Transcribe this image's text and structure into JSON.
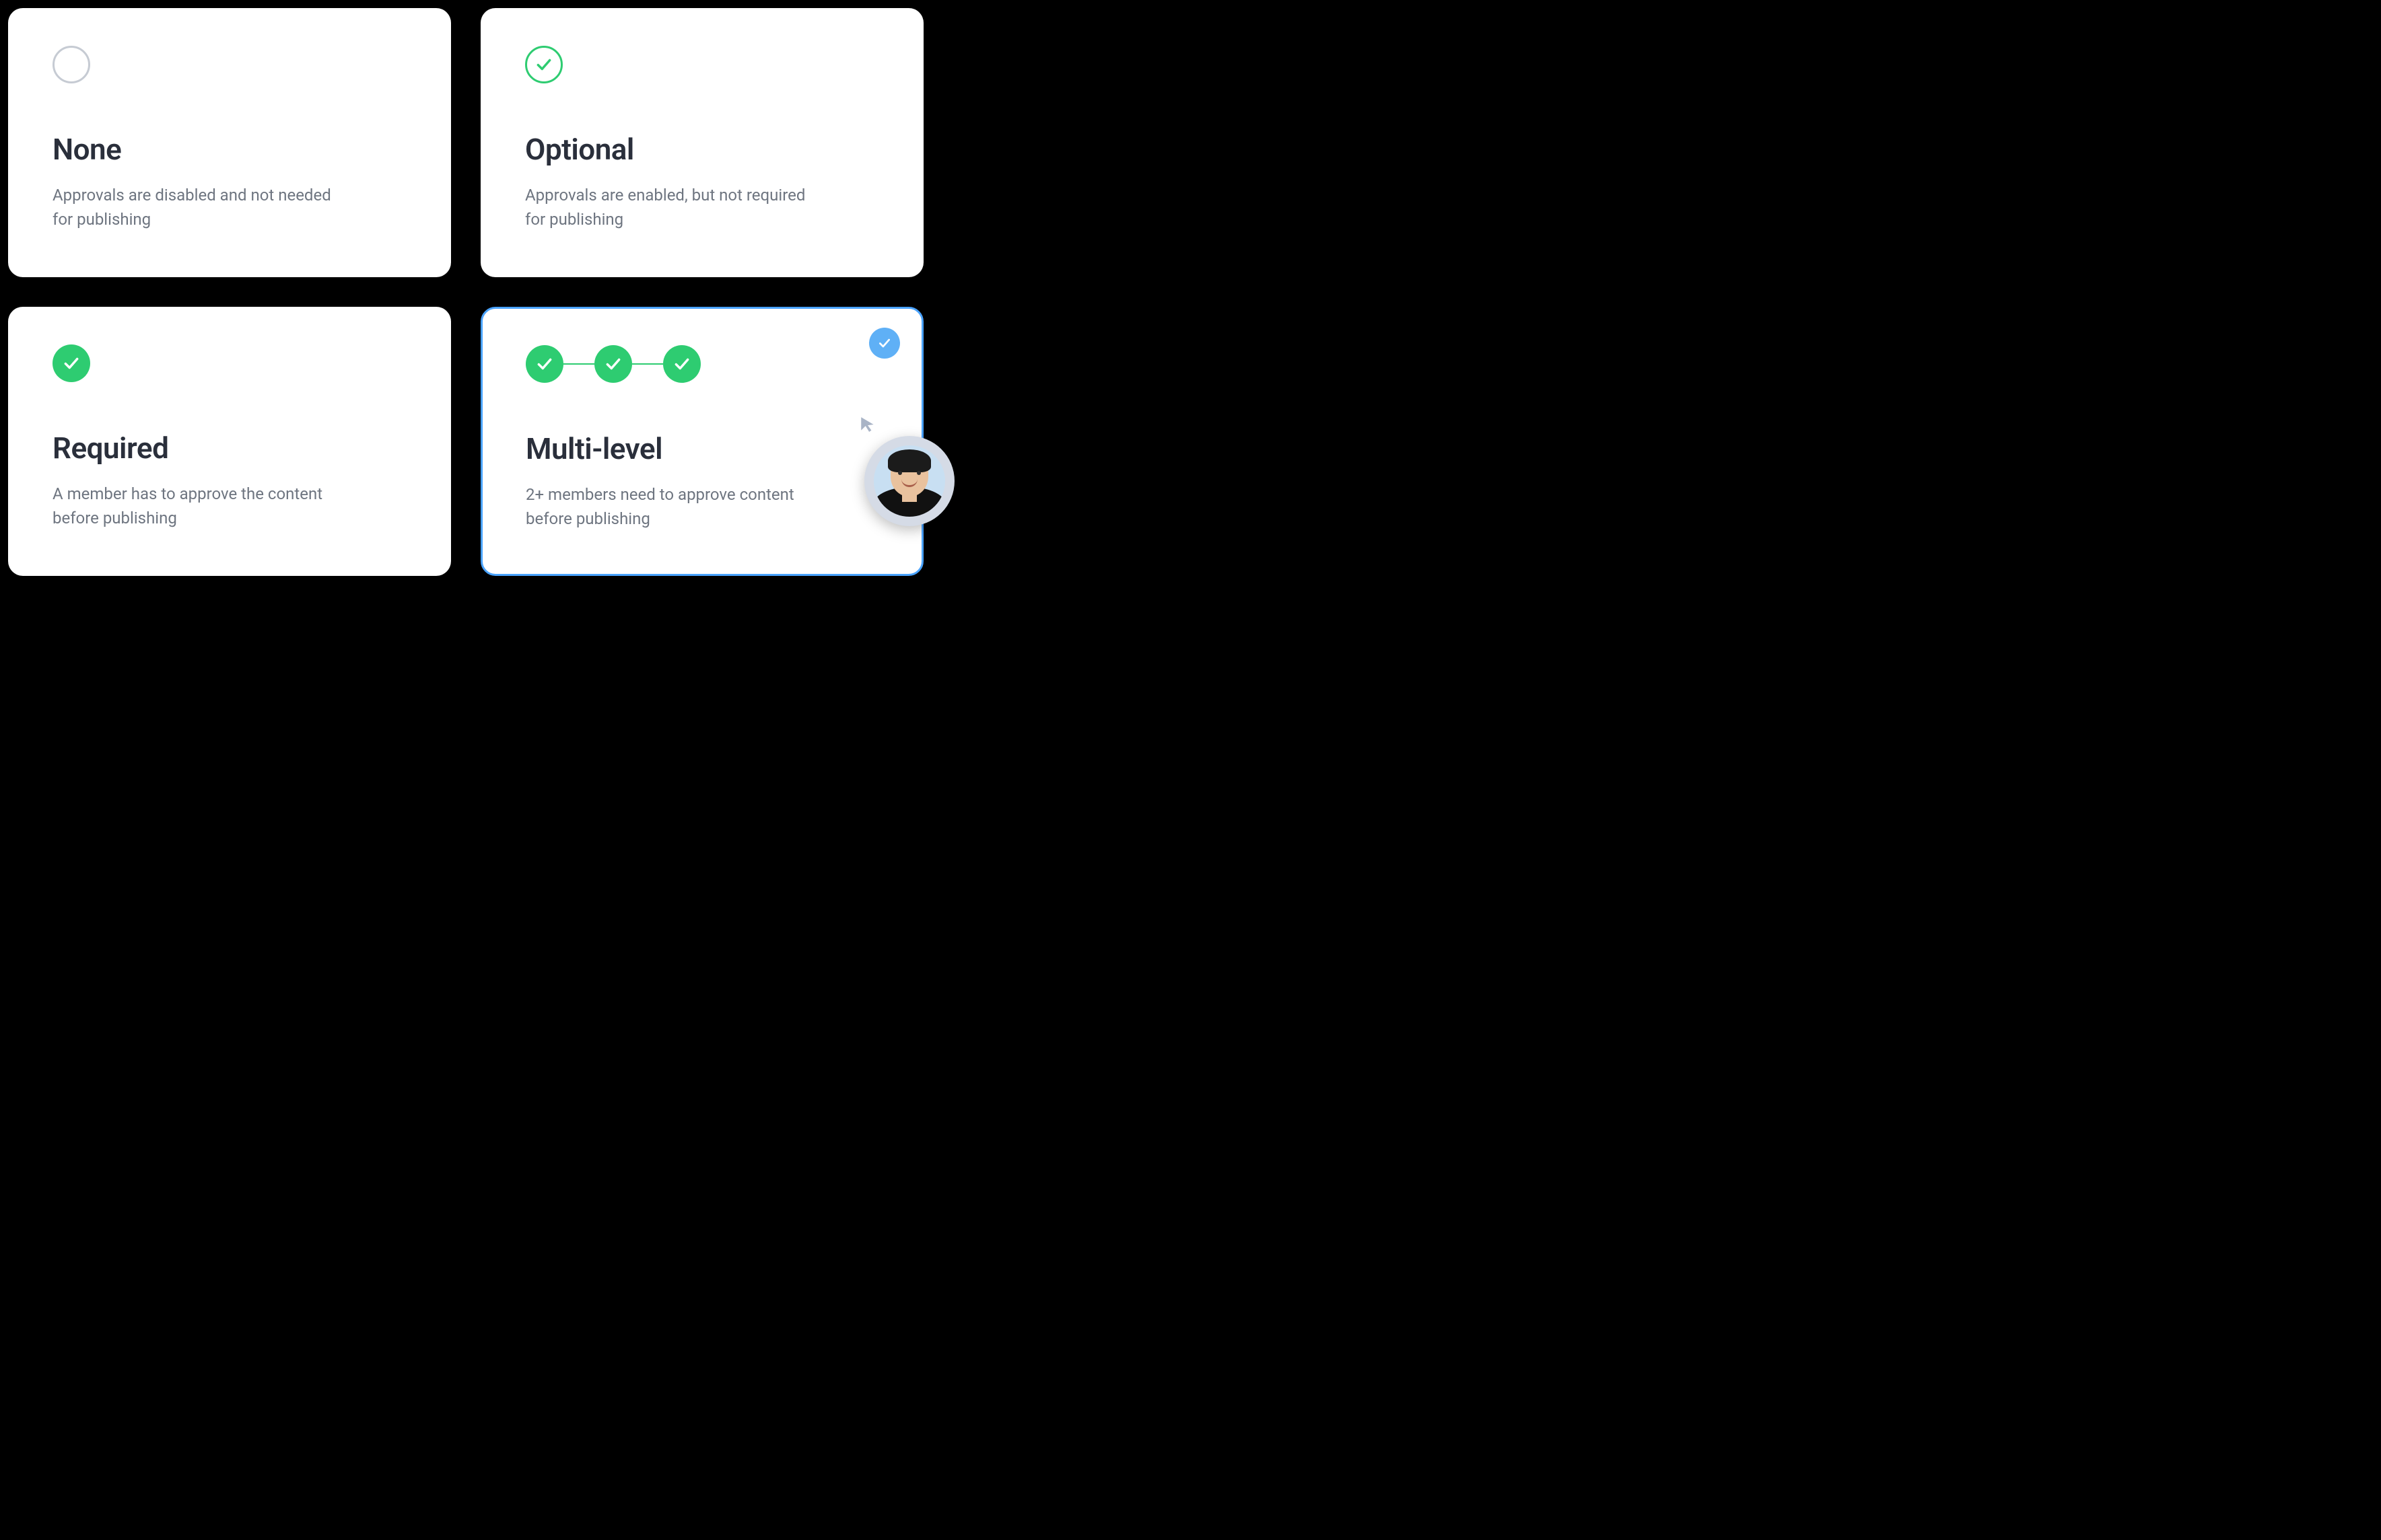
{
  "options": [
    {
      "id": "none",
      "title": "None",
      "description": "Approvals are disabled and not needed for publishing",
      "icon": "empty-circle",
      "selected": false
    },
    {
      "id": "optional",
      "title": "Optional",
      "description": "Approvals are enabled, but not required for publishing",
      "icon": "outline-check",
      "selected": false
    },
    {
      "id": "required",
      "title": "Required",
      "description": "A member has to approve the content before publishing",
      "icon": "filled-check",
      "selected": false
    },
    {
      "id": "multi-level",
      "title": "Multi-level",
      "description": "2+ members need to approve content before publishing",
      "icon": "multi-step-check",
      "selected": true
    }
  ],
  "colors": {
    "accent_green": "#2ecc71",
    "accent_blue": "#4aa3ff",
    "text_primary": "#2a2f3b",
    "text_secondary": "#6e7580"
  }
}
